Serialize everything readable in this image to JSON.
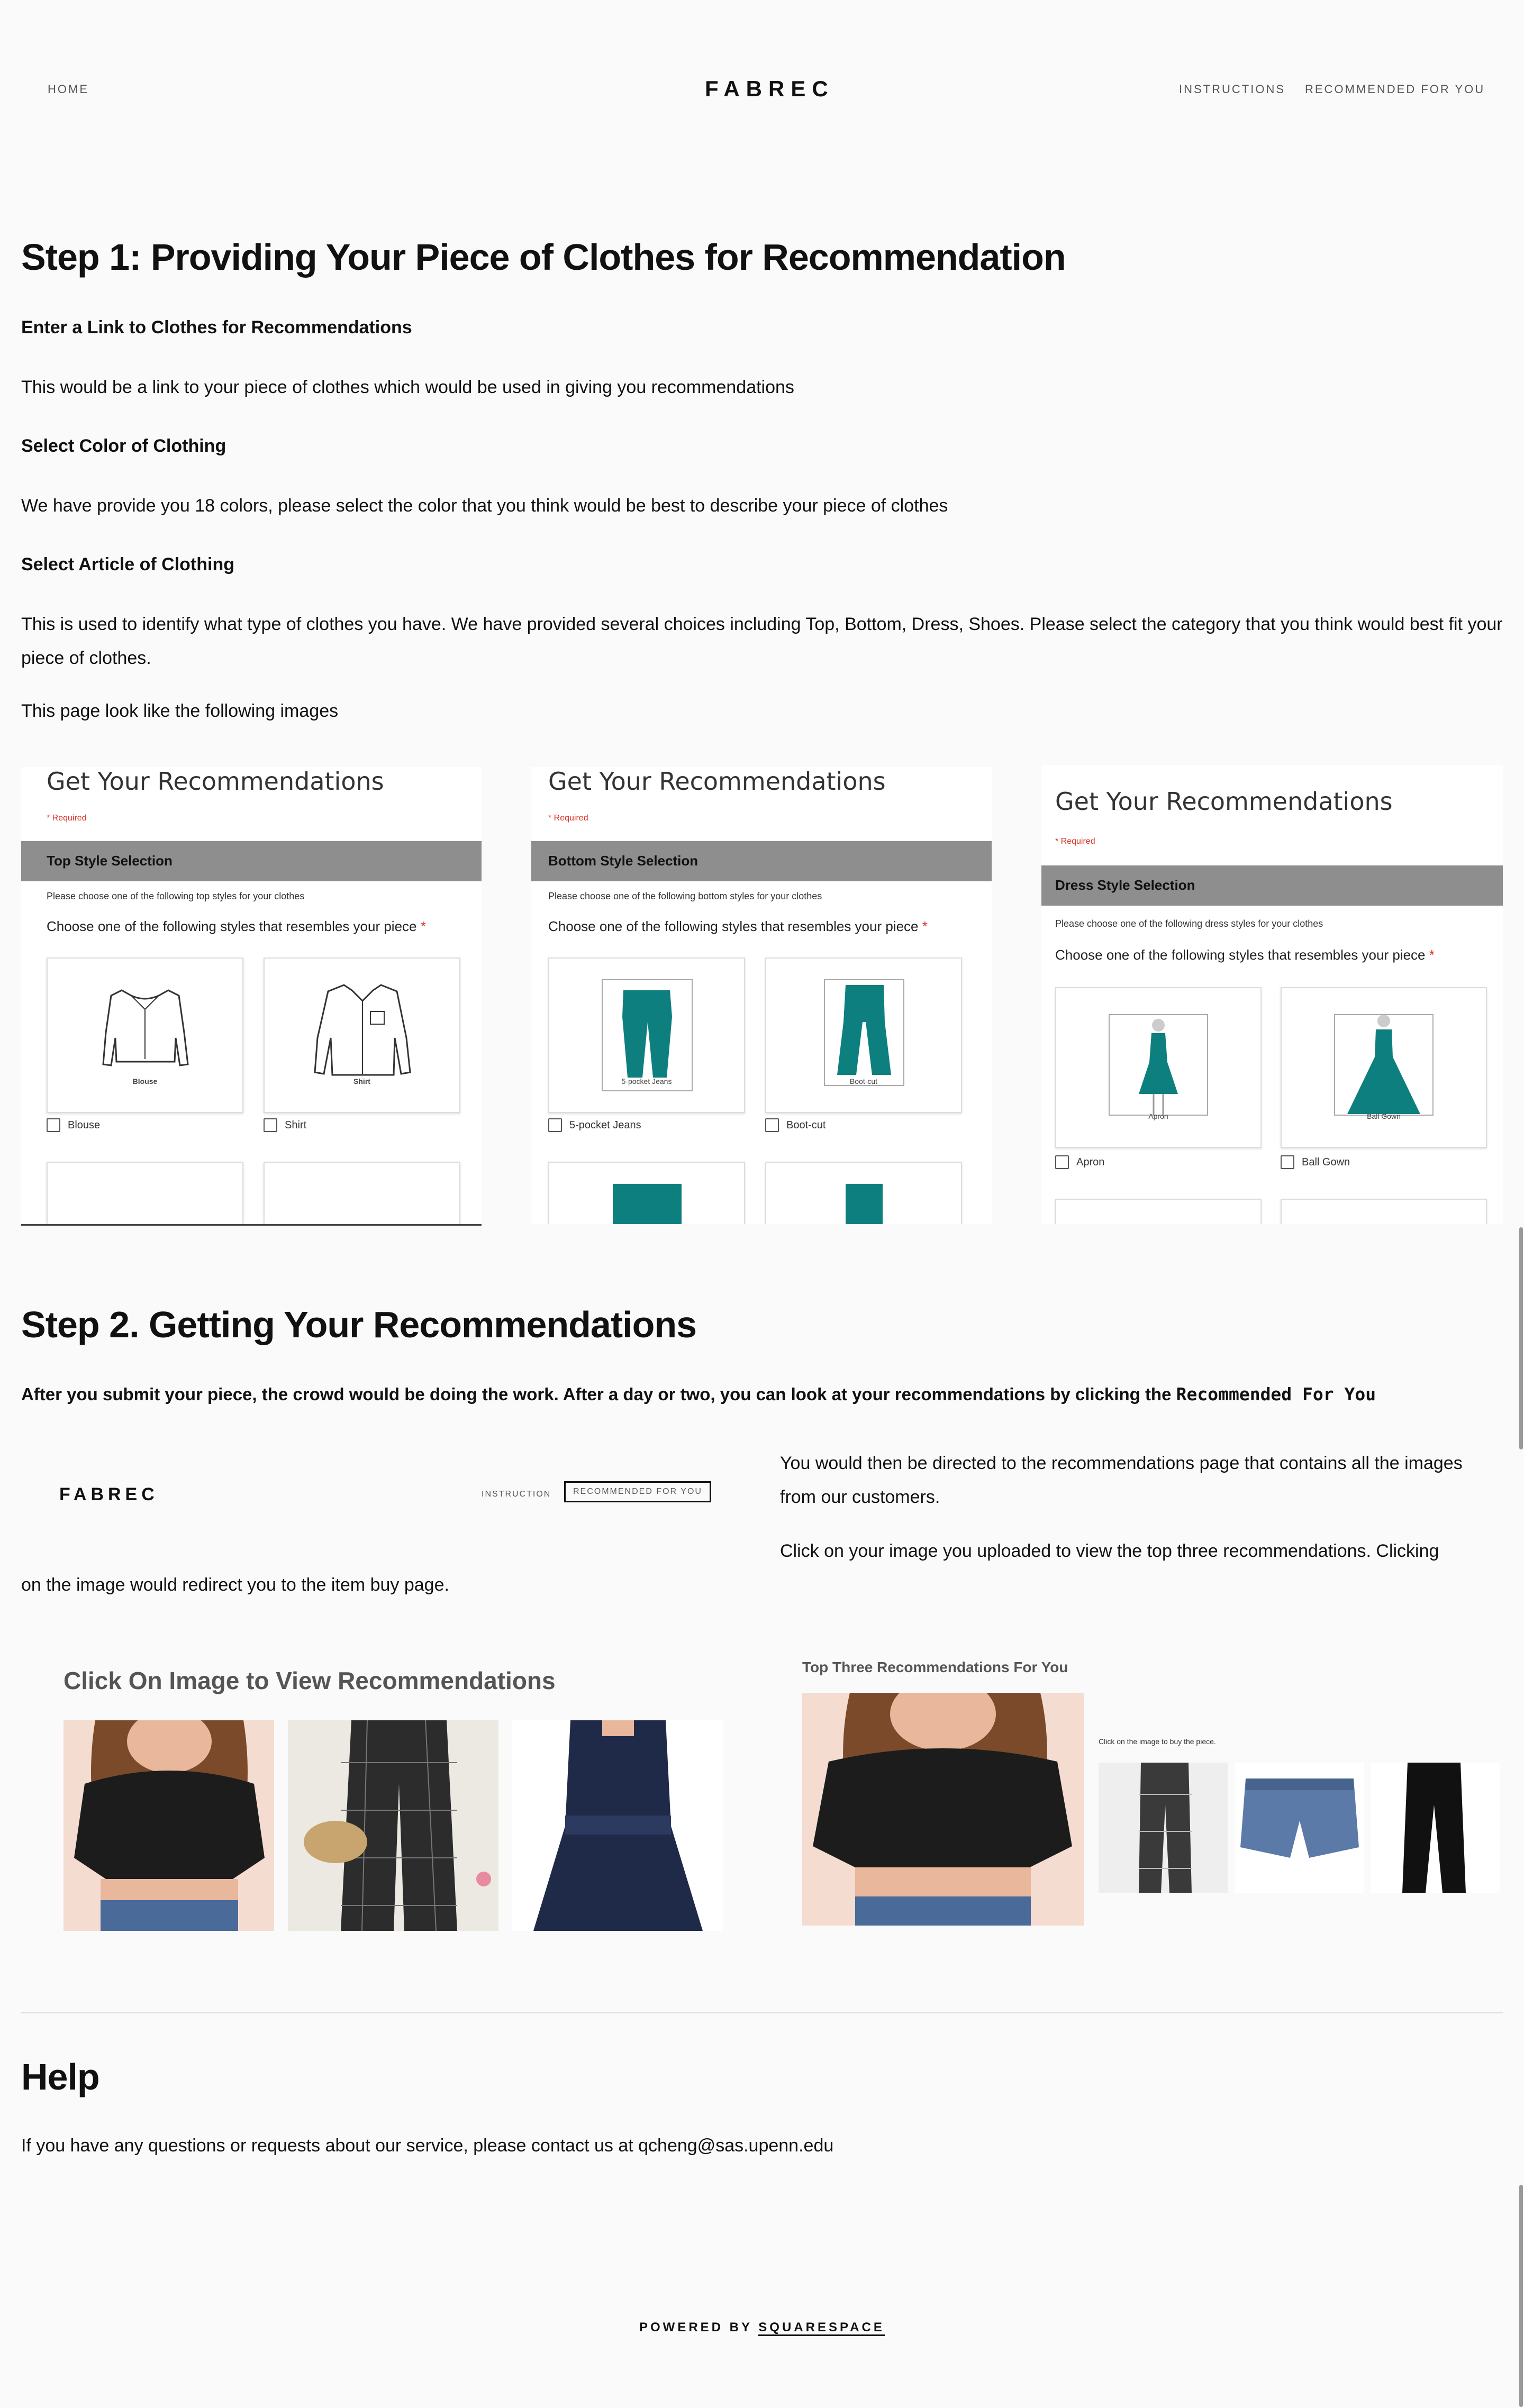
{
  "header": {
    "home": "HOME",
    "brand": "FABREC",
    "instructions": "INSTRUCTIONS",
    "recommended": "RECOMMENDED FOR YOU"
  },
  "step1": {
    "title": "Step 1: Providing Your Piece of Clothes for Recommendation",
    "link_heading": "Enter a Link to Clothes for Recommendations",
    "link_text": "This would be a link to your piece of clothes which would be used in giving you recommendations",
    "color_heading": "Select Color of Clothing",
    "color_text": "We have provide you 18 colors, please select the color that you think would be best to describe your piece of clothes",
    "article_heading": "Select Article of Clothing",
    "article_text": "This is used to identify what type of clothes you have. We have provided several choices including Top, Bottom, Dress, Shoes. Please select the category that you think would best fit your piece of clothes.",
    "page_look": "This page look like the following images"
  },
  "forms": [
    {
      "title": "Get Your Recommendations",
      "required": "* Required",
      "section": "Top Style Selection",
      "hint": "Please choose one of the following top styles for your clothes",
      "question": "Choose one of the following styles that resembles your piece",
      "star": "*",
      "options": [
        {
          "image_label": "Blouse",
          "label": "Blouse"
        },
        {
          "image_label": "Shirt",
          "label": "Shirt"
        }
      ]
    },
    {
      "title": "Get Your Recommendations",
      "required": "* Required",
      "section": "Bottom Style Selection",
      "hint": "Please choose one of the following bottom styles for your clothes",
      "question": "Choose one of the following styles that resembles your piece",
      "star": "*",
      "options": [
        {
          "image_label": "5-pocket Jeans",
          "label": "5-pocket Jeans"
        },
        {
          "image_label": "Boot-cut",
          "label": "Boot-cut"
        }
      ]
    },
    {
      "title": "Get Your Recommendations",
      "required": "* Required",
      "section": "Dress Style Selection",
      "hint": "Please choose one of the following dress styles for your clothes",
      "question": "Choose one of the following styles that resembles your piece",
      "star": "*",
      "options": [
        {
          "image_label": "Apron",
          "label": "Apron"
        },
        {
          "image_label": "Ball Gown",
          "label": "Ball Gown"
        }
      ]
    }
  ],
  "step2": {
    "title": "Step 2. Getting Your Recommendations",
    "intro": "After you submit your piece, the crowd would be doing the work. After a day or two, you can look at your recommendations by clicking the",
    "intro_code": "Recommended For You",
    "mini_nav": {
      "brand": "FABREC",
      "instruction": "INSTRUCTION",
      "recommended": "RECOMMENDED FOR YOU"
    },
    "directed": "You would then be directed to the recommendations page that contains all the images from our customers.",
    "click_a": "Click on your image you uploaded to view the top three recommendations. Clicking",
    "click_b": "on the image would redirect you to the item buy page.",
    "gallery_title": "Click On Image to View Recommendations",
    "top_three_title": "Top Three Recommendations For You",
    "buy_hint": "Click on the image to buy the piece."
  },
  "help": {
    "title": "Help",
    "text": "If you have any questions or requests about our service, please contact us at qcheng@sas.upenn.edu"
  },
  "footer": {
    "powered": "POWERED BY",
    "squarespace": "SQUARESPACE"
  },
  "colors": {
    "teal": "#0e7f7f",
    "required_red": "#d93025",
    "section_bar": "#8e8e8e",
    "page_bg": "#fafafa"
  }
}
